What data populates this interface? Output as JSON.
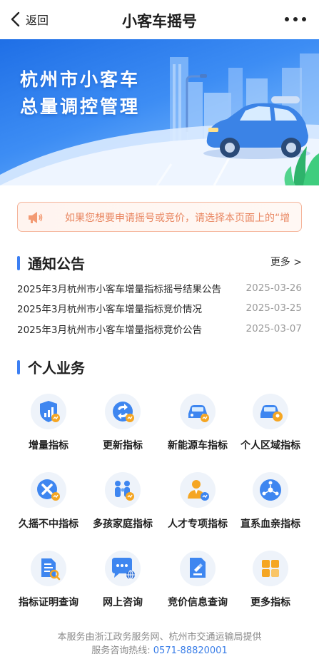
{
  "navbar": {
    "back_label": "返回",
    "title": "小客车摇号"
  },
  "banner": {
    "title_line1": "杭州市小客车",
    "title_line2": "总量调控管理"
  },
  "notice_bar": {
    "text": "如果您想要申请摇号或竞价，请选择本页面上的“增"
  },
  "announcements": {
    "heading": "通知公告",
    "more_label": "更多 >",
    "items": [
      {
        "title": "2025年3月杭州市小客车增量指标摇号结果公告",
        "date": "2025-03-26"
      },
      {
        "title": "2025年3月杭州市小客车增量指标竞价情况",
        "date": "2025-03-25"
      },
      {
        "title": "2025年3月杭州市小客车增量指标竞价公告",
        "date": "2025-03-07"
      }
    ]
  },
  "services": {
    "heading": "个人业务",
    "items": [
      {
        "label": "增量指标",
        "icon": "shield-growth-icon"
      },
      {
        "label": "更新指标",
        "icon": "refresh-icon"
      },
      {
        "label": "新能源车指标",
        "icon": "ev-car-icon"
      },
      {
        "label": "个人区域指标",
        "icon": "car-location-icon"
      },
      {
        "label": "久摇不中指标",
        "icon": "cross-icon"
      },
      {
        "label": "多孩家庭指标",
        "icon": "family-icon"
      },
      {
        "label": "人才专项指标",
        "icon": "talent-icon"
      },
      {
        "label": "直系血亲指标",
        "icon": "relatives-icon"
      },
      {
        "label": "指标证明查询",
        "icon": "document-search-icon"
      },
      {
        "label": "网上咨询",
        "icon": "chat-icon"
      },
      {
        "label": "竞价信息查询",
        "icon": "bid-document-icon"
      },
      {
        "label": "更多指标",
        "icon": "grid-icon"
      }
    ]
  },
  "footer": {
    "line1": "本服务由浙江政务服务网、杭州市交通运输局提供",
    "hotline_label": "服务咨询热线:",
    "hotline_number": "0571-88820001"
  },
  "colors": {
    "accent": "#3c7ff3",
    "notice_text": "#e98762",
    "notice_border": "#f5b49a",
    "icon_blue": "#3e86f0",
    "icon_orange": "#f5a623"
  }
}
